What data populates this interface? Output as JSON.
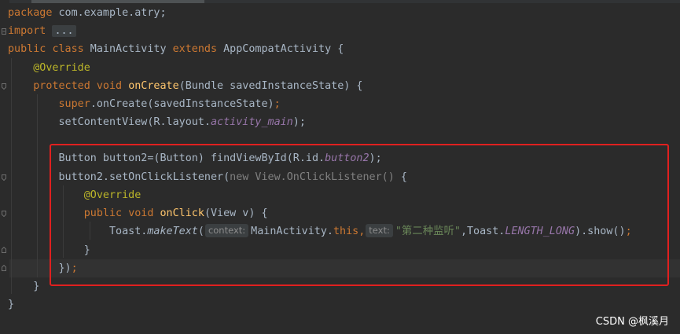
{
  "editor": {
    "line_package": {
      "kw": "package",
      "rest": " com.example.atry;"
    },
    "line_import": {
      "kw": "import",
      "collapsed": "..."
    },
    "line_class": {
      "kw1": "public",
      "kw2": "class",
      "name": " MainActivity ",
      "kw3": "extends",
      "rest": " AppCompatActivity {"
    },
    "line_override1": {
      "ann": "@Override"
    },
    "line_oncreate": {
      "kw1": "protected",
      "kw2": "void",
      "fn": "onCreate",
      "rest": "(Bundle savedInstanceState) {"
    },
    "line_super": {
      "kw": "super",
      "rest": ".onCreate(savedInstanceState)",
      "semi": ";"
    },
    "line_setcontent": {
      "pre": "setContentView(R.layout.",
      "ital": "activity_main",
      "post": ");"
    },
    "line_button": {
      "pre": "Button button2=(Button) findViewById(R.id.",
      "ital": "button2",
      "post": ");"
    },
    "line_listener": {
      "pre": "button2.setOnClickListener(",
      "dim": "new View.OnClickListener()",
      "post": " {"
    },
    "line_override2": {
      "ann": "@Override"
    },
    "line_onclick": {
      "kw1": "public",
      "kw2": "void",
      "fn": "onClick",
      "rest": "(View v) {"
    },
    "line_toast": {
      "pre": "Toast.",
      "method": "makeText",
      "open": "(",
      "hint_context": "context:",
      "arg1": "MainActivity.",
      "this": "this",
      "comma1": ",",
      "hint_text": "text:",
      "str": "\"第二种监听\"",
      "comma2": ",Toast.",
      "const": "LENGTH_LONG",
      "post": ").show()",
      "semi": ";"
    },
    "line_close_inner": {
      "text": "}"
    },
    "line_close_listener": {
      "text": "})",
      "semi": ";"
    },
    "line_close_method": {
      "text": "}"
    },
    "line_close_class": {
      "text": "}"
    }
  },
  "watermark": "CSDN @枫溪月",
  "colors": {
    "background": "#2b2b2b",
    "keyword": "#cc7832",
    "annotation": "#bbb529",
    "method": "#ffc66d",
    "field": "#9876aa",
    "string": "#6a8759",
    "text": "#a9b7c6",
    "highlight_box": "#e0201f"
  }
}
